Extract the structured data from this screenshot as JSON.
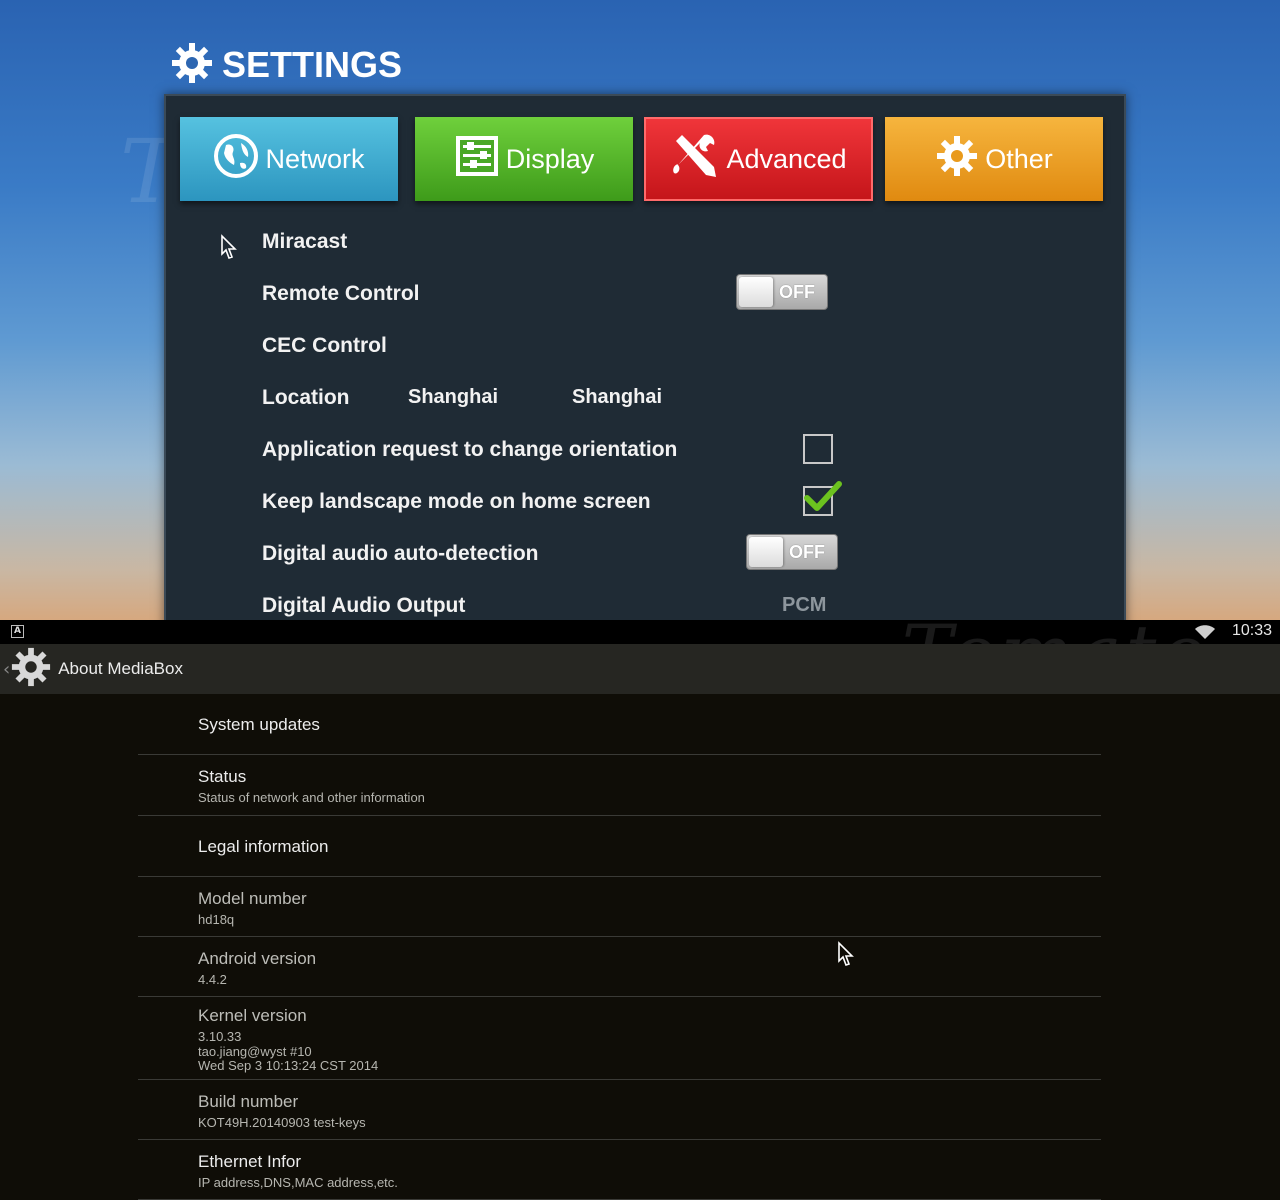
{
  "settings": {
    "title": "SETTINGS",
    "tabs": [
      {
        "label": "Network",
        "icon": "globe-icon"
      },
      {
        "label": "Display",
        "icon": "display-sliders-icon"
      },
      {
        "label": "Advanced",
        "icon": "tools-icon"
      },
      {
        "label": "Other",
        "icon": "gear-icon"
      }
    ],
    "rows": {
      "miracast": "Miracast",
      "remote_control": "Remote Control",
      "remote_control_toggle": "OFF",
      "cec_control": "CEC Control",
      "location": "Location",
      "location_value_1": "Shanghai",
      "location_value_2": "Shanghai",
      "app_orientation": "Application request to change orientation",
      "app_orientation_checked": false,
      "keep_landscape": "Keep landscape mode on home screen",
      "keep_landscape_checked": true,
      "digital_audio_auto": "Digital audio auto-detection",
      "digital_audio_auto_toggle": "OFF",
      "digital_audio_output": "Digital Audio Output",
      "digital_audio_output_value": "PCM"
    },
    "watermark": "Tomato"
  },
  "about": {
    "statusbar": {
      "notification": "A",
      "time": "10:33"
    },
    "title": "About MediaBox",
    "items": [
      {
        "title": "System updates",
        "sub": []
      },
      {
        "title": "Status",
        "sub": [
          "Status of network and other information"
        ]
      },
      {
        "title": "Legal information",
        "sub": []
      },
      {
        "title": "Model number",
        "sub": [
          "hd18q"
        ]
      },
      {
        "title": "Android version",
        "sub": [
          "4.4.2"
        ]
      },
      {
        "title": "Kernel version",
        "sub": [
          "3.10.33",
          "tao.jiang@wyst #10",
          "Wed Sep 3 10:13:24 CST 2014"
        ]
      },
      {
        "title": "Build number",
        "sub": [
          "KOT49H.20140903 test-keys"
        ]
      },
      {
        "title": "Ethernet Infor",
        "sub": [
          "IP address,DNS,MAC address,etc."
        ]
      }
    ]
  },
  "colors": {
    "network": "#2c95bf",
    "display": "#3e9b1a",
    "advanced": "#c5151a",
    "other": "#e08a10",
    "check": "#6cc21f"
  }
}
